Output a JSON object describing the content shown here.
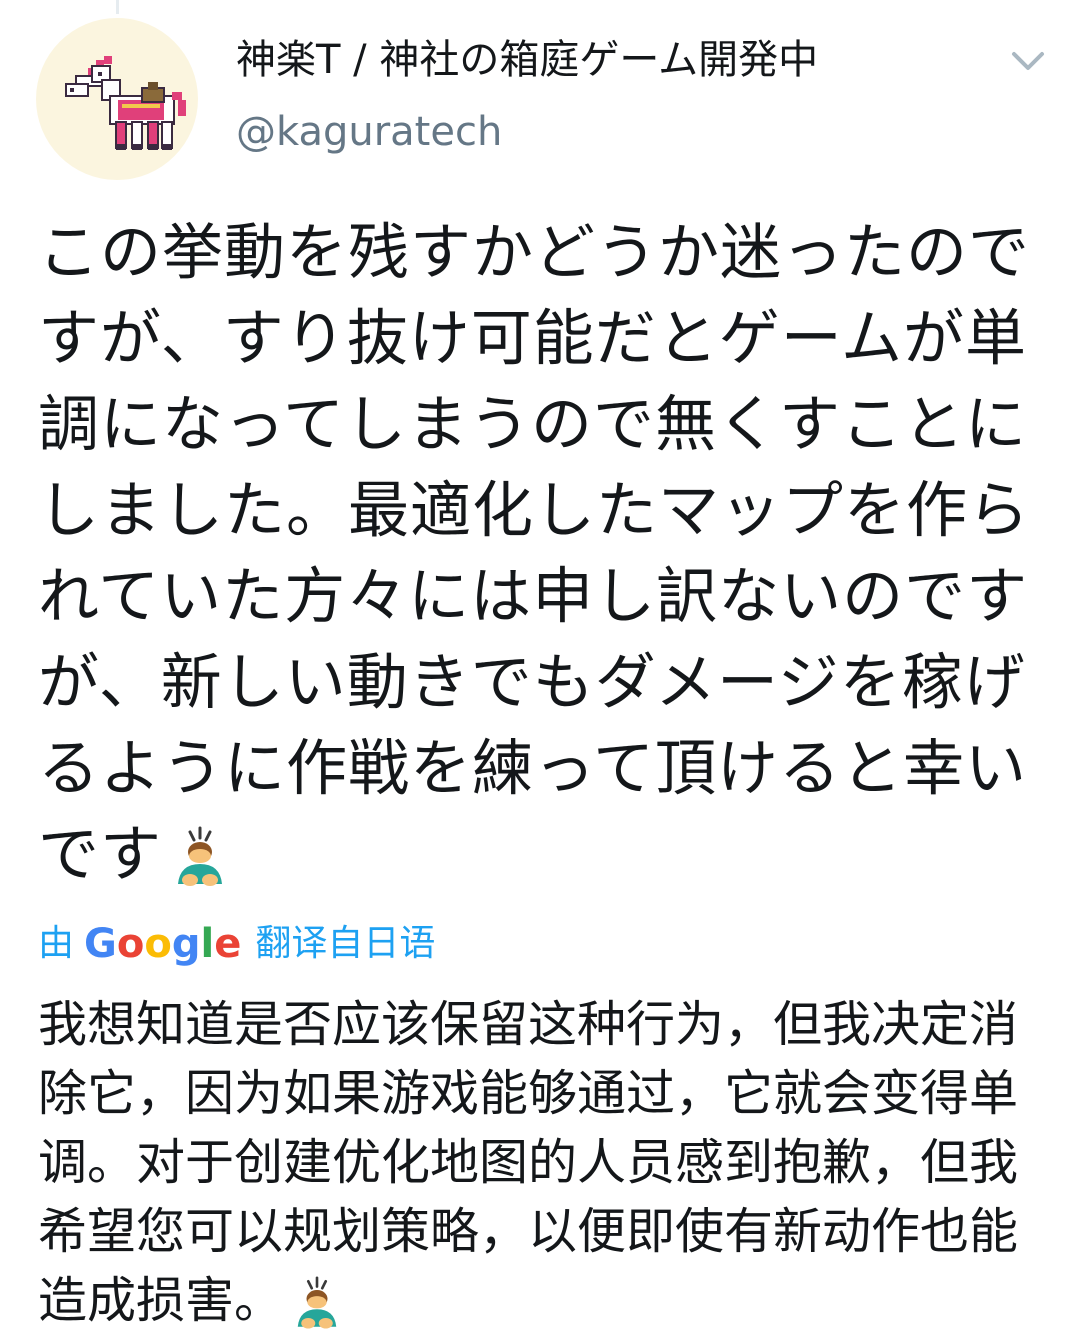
{
  "profile": {
    "display_name": "神楽T / 神社の箱庭ゲーム開発中",
    "handle": "@kaguratech",
    "avatar_icon": "pixel-horse-icon",
    "menu_icon": "chevron-down-icon"
  },
  "tweet": {
    "text": "この挙動を残すかどうか迷ったのですが、すり抜け可能だとゲームが単調になってしまうので無くすことにしました。最適化したマップを作られていた方々には申し訳ないのですが、新しい動きでもダメージを稼げるように作戦を練って頂けると幸いです",
    "emoji": "person-bowing-icon"
  },
  "translation": {
    "prefix": "由",
    "provider_letters": [
      "G",
      "o",
      "o",
      "g",
      "l",
      "e"
    ],
    "suffix": "翻译自日语",
    "text": "我想知道是否应该保留这种行为，但我决定消除它，因为如果游戏能够通过，它就会变得单调。对于创建优化地图的人员感到抱歉，但我希望您可以规划策略，以便即使有新动作也能造成损害。",
    "emoji": "person-bowing-icon"
  },
  "colors": {
    "text": "#14171a",
    "secondary": "#657786",
    "link": "#1da1f2",
    "avatar_bg": "#fbf5df"
  }
}
